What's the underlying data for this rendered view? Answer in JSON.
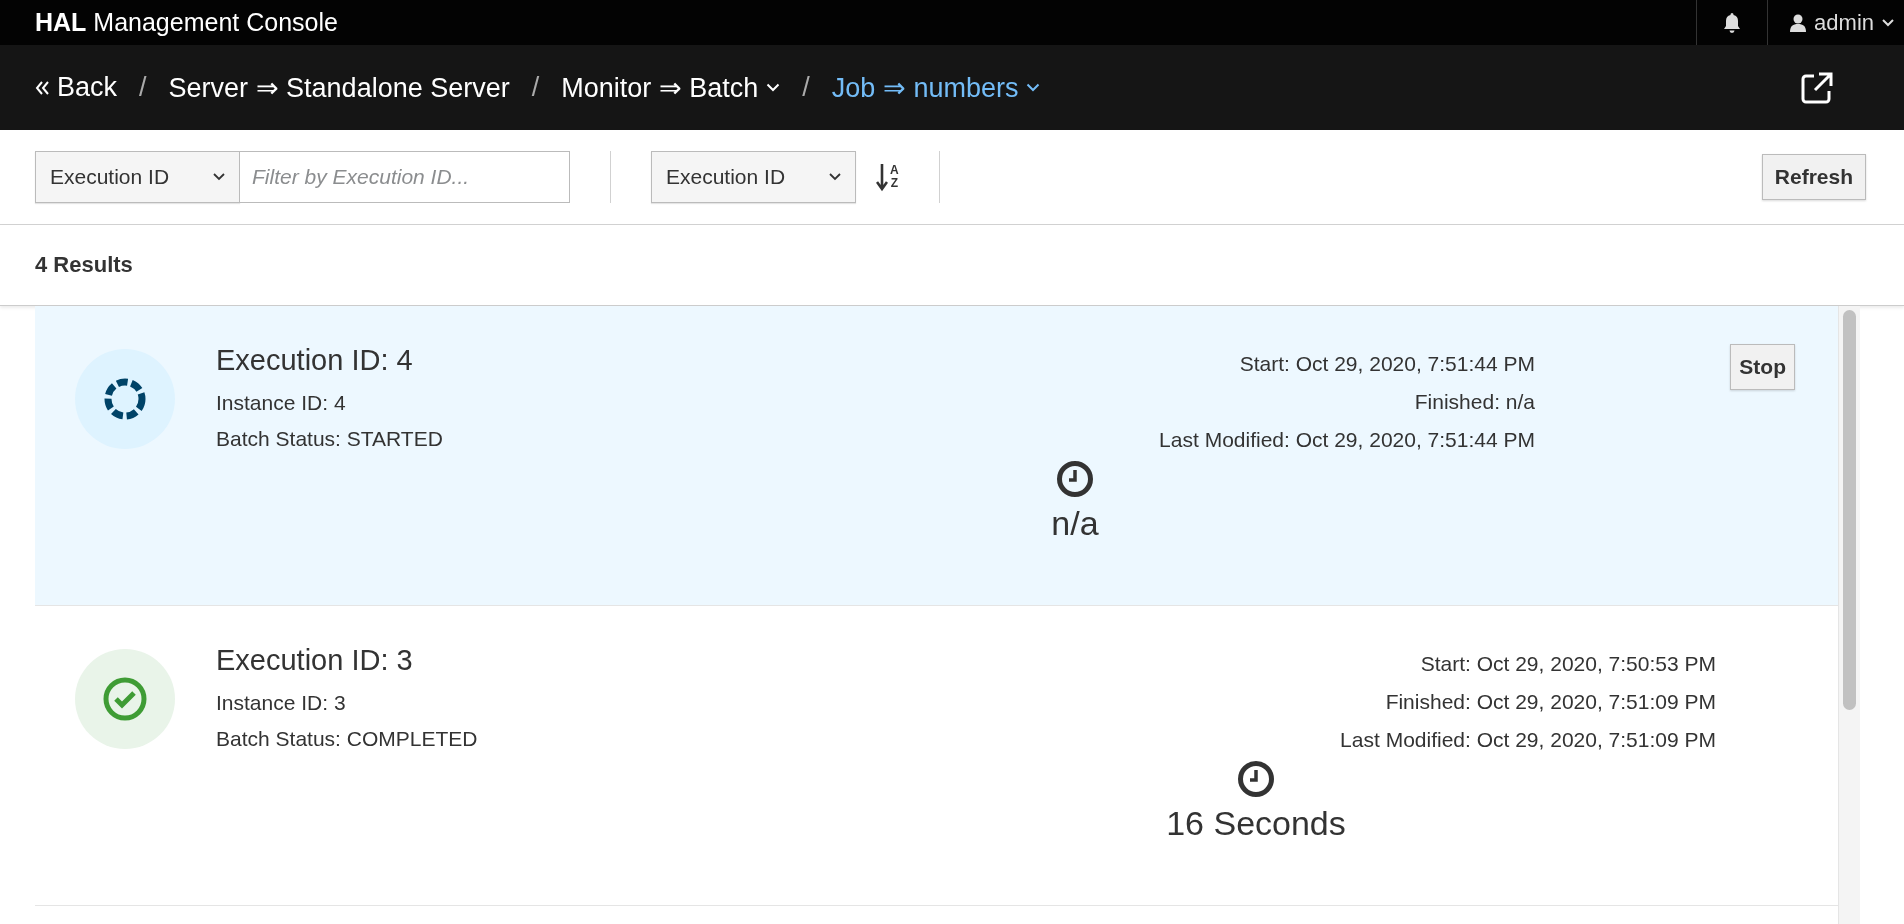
{
  "masthead": {
    "title_bold": "HAL",
    "title": "Management Console",
    "user": "admin"
  },
  "breadcrumb": {
    "back": "Back",
    "separator": "/",
    "items": [
      {
        "label": "Server ⇒ Standalone Server",
        "current": false,
        "menu": false
      },
      {
        "label": "Monitor ⇒ Batch",
        "current": false,
        "menu": true
      },
      {
        "label": "Job ⇒ numbers",
        "current": true,
        "menu": true
      }
    ]
  },
  "toolbar": {
    "filter_field": "Execution ID",
    "filter": {
      "placeholder": "Filter by Execution ID..."
    },
    "sort_field": "Execution ID",
    "sort_letters": [
      "A",
      "Z"
    ],
    "refresh": "Refresh"
  },
  "results": "4 Results",
  "executions": [
    {
      "kind": "started",
      "selected": true,
      "title": "Execution ID: 4",
      "instance": "Instance ID: 4",
      "status": "Batch Status: STARTED",
      "start": "Start: Oct 29, 2020, 7:51:44 PM",
      "finished": "Finished: n/a",
      "modified": "Last Modified: Oct 29, 2020, 7:51:44 PM",
      "duration": "n/a",
      "action": "Stop"
    },
    {
      "kind": "completed",
      "selected": false,
      "title": "Execution ID: 3",
      "instance": "Instance ID: 3",
      "status": "Batch Status: COMPLETED",
      "start": "Start: Oct 29, 2020, 7:50:53 PM",
      "finished": "Finished: Oct 29, 2020, 7:51:09 PM",
      "modified": "Last Modified: Oct 29, 2020, 7:51:09 PM",
      "duration": "16 Seconds"
    }
  ]
}
